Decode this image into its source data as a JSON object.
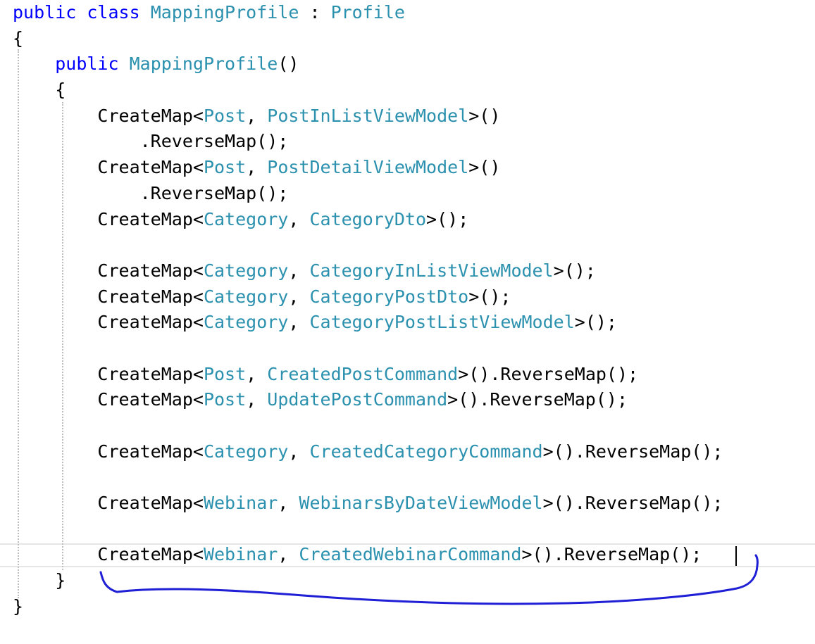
{
  "editor": {
    "lines": [
      [
        {
          "t": "public",
          "c": "kw"
        },
        {
          "t": " "
        },
        {
          "t": "class",
          "c": "kw"
        },
        {
          "t": " "
        },
        {
          "t": "MappingProfile",
          "c": "type"
        },
        {
          "t": " : "
        },
        {
          "t": "Profile",
          "c": "type"
        }
      ],
      [
        {
          "t": "{"
        }
      ],
      [
        {
          "t": "    "
        },
        {
          "t": "public",
          "c": "kw"
        },
        {
          "t": " "
        },
        {
          "t": "MappingProfile",
          "c": "type"
        },
        {
          "t": "()"
        }
      ],
      [
        {
          "t": "    {"
        }
      ],
      [
        {
          "t": "        CreateMap<"
        },
        {
          "t": "Post",
          "c": "type"
        },
        {
          "t": ", "
        },
        {
          "t": "PostInListViewModel",
          "c": "type"
        },
        {
          "t": ">()"
        }
      ],
      [
        {
          "t": "            .ReverseMap();"
        }
      ],
      [
        {
          "t": "        CreateMap<"
        },
        {
          "t": "Post",
          "c": "type"
        },
        {
          "t": ", "
        },
        {
          "t": "PostDetailViewModel",
          "c": "type"
        },
        {
          "t": ">()"
        }
      ],
      [
        {
          "t": "            .ReverseMap();"
        }
      ],
      [
        {
          "t": "        CreateMap<"
        },
        {
          "t": "Category",
          "c": "type"
        },
        {
          "t": ", "
        },
        {
          "t": "CategoryDto",
          "c": "type"
        },
        {
          "t": ">();"
        }
      ],
      [],
      [
        {
          "t": "        CreateMap<"
        },
        {
          "t": "Category",
          "c": "type"
        },
        {
          "t": ", "
        },
        {
          "t": "CategoryInListViewModel",
          "c": "type"
        },
        {
          "t": ">();"
        }
      ],
      [
        {
          "t": "        CreateMap<"
        },
        {
          "t": "Category",
          "c": "type"
        },
        {
          "t": ", "
        },
        {
          "t": "CategoryPostDto",
          "c": "type"
        },
        {
          "t": ">();"
        }
      ],
      [
        {
          "t": "        CreateMap<"
        },
        {
          "t": "Category",
          "c": "type"
        },
        {
          "t": ", "
        },
        {
          "t": "CategoryPostListViewModel",
          "c": "type"
        },
        {
          "t": ">();"
        }
      ],
      [],
      [
        {
          "t": "        CreateMap<"
        },
        {
          "t": "Post",
          "c": "type"
        },
        {
          "t": ", "
        },
        {
          "t": "CreatedPostCommand",
          "c": "type"
        },
        {
          "t": ">().ReverseMap();"
        }
      ],
      [
        {
          "t": "        CreateMap<"
        },
        {
          "t": "Post",
          "c": "type"
        },
        {
          "t": ", "
        },
        {
          "t": "UpdatePostCommand",
          "c": "type"
        },
        {
          "t": ">().ReverseMap();"
        }
      ],
      [],
      [
        {
          "t": "        CreateMap<"
        },
        {
          "t": "Category",
          "c": "type"
        },
        {
          "t": ", "
        },
        {
          "t": "CreatedCategoryCommand",
          "c": "type"
        },
        {
          "t": ">().ReverseMap();"
        }
      ],
      [],
      [
        {
          "t": "        CreateMap<"
        },
        {
          "t": "Webinar",
          "c": "type"
        },
        {
          "t": ", "
        },
        {
          "t": "WebinarsByDateViewModel",
          "c": "type"
        },
        {
          "t": ">().ReverseMap();"
        }
      ],
      [],
      [
        {
          "t": "        CreateMap<"
        },
        {
          "t": "Webinar",
          "c": "type"
        },
        {
          "t": ", "
        },
        {
          "t": "CreatedWebinarCommand",
          "c": "type"
        },
        {
          "t": ">().ReverseMap();"
        }
      ],
      [
        {
          "t": "    }"
        }
      ],
      [
        {
          "t": "}"
        }
      ]
    ],
    "colors": {
      "keyword": "#0000ff",
      "type": "#2b91af",
      "text": "#000000",
      "annotation": "#1f1fd6"
    }
  }
}
